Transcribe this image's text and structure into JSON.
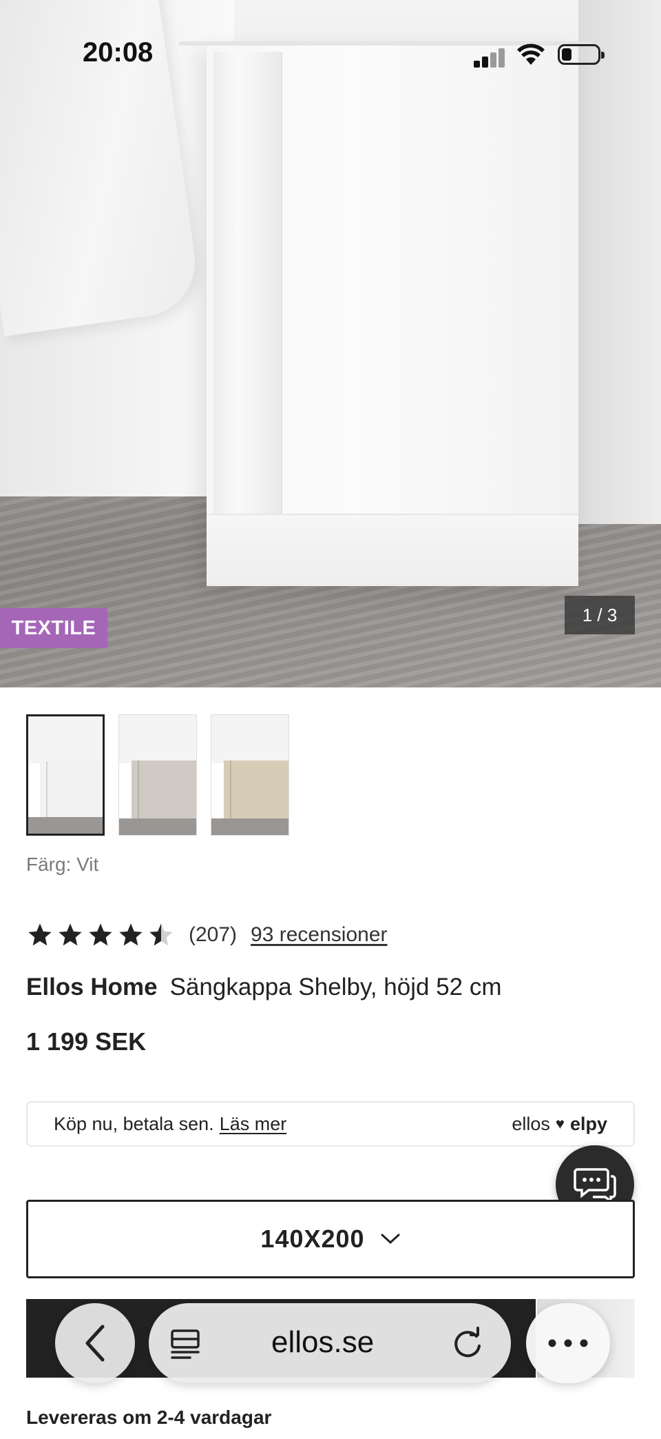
{
  "status_bar": {
    "time": "20:08"
  },
  "gallery": {
    "badge": "TEXTILE",
    "counter": "1 / 3",
    "badge_color": "#a566b8",
    "thumbnails": [
      {
        "color": "#f2f2f2",
        "selected": true
      },
      {
        "color": "#cfcac3",
        "selected": false
      },
      {
        "color": "#d7ccb6",
        "selected": false
      }
    ]
  },
  "product": {
    "color_label": "Färg: Vit",
    "rating": 4.5,
    "rating_count": "(207)",
    "reviews_link": "93 recensioner",
    "brand": "Ellos Home",
    "name": "Sängkappa Shelby, höjd 52 cm",
    "price": "1 199 SEK"
  },
  "pay_later": {
    "text": "Köp nu, betala sen.",
    "link": "Läs mer",
    "logo_left": "ellos",
    "logo_right": "elpy"
  },
  "size_select": {
    "value": "140X200"
  },
  "browser": {
    "url": "ellos.se"
  },
  "delivery": {
    "text": "Levereras om 2-4 vardagar"
  }
}
